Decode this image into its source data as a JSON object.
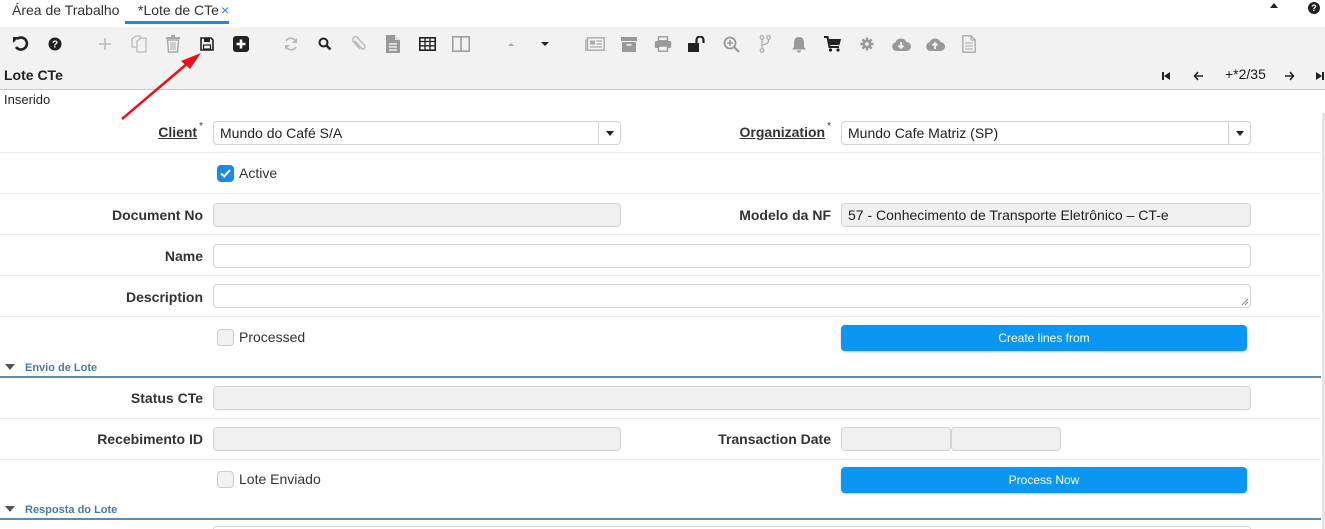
{
  "tabs": [
    {
      "label": "Área de Trabalho",
      "active": false
    },
    {
      "label": "*Lote de CTe",
      "active": true,
      "close": "×"
    }
  ],
  "tabbar_right": {
    "collapse_icon": "caret-up-icon",
    "help": "?"
  },
  "toolbar": {
    "buttons": [
      {
        "name": "undo",
        "icon": "undo-icon",
        "enabled": true
      },
      {
        "name": "help",
        "icon": "help-icon",
        "enabled": true
      },
      {
        "name": "new",
        "icon": "plus-icon",
        "enabled": false
      },
      {
        "name": "copy",
        "icon": "copy-icon",
        "enabled": false
      },
      {
        "name": "delete",
        "icon": "trash-icon",
        "enabled": false
      },
      {
        "name": "save",
        "icon": "save-icon",
        "enabled": true
      },
      {
        "name": "save-and-new",
        "icon": "plus-square-icon",
        "enabled": true
      },
      {
        "name": "refresh",
        "icon": "refresh-icon",
        "enabled": false
      },
      {
        "name": "find",
        "icon": "search-icon",
        "enabled": true
      },
      {
        "name": "attachment",
        "icon": "paperclip-icon",
        "enabled": false
      },
      {
        "name": "note",
        "icon": "document-icon",
        "enabled": false
      },
      {
        "name": "grid-toggle",
        "icon": "grid-icon",
        "enabled": true
      },
      {
        "name": "split-view",
        "icon": "columns-icon",
        "enabled": false
      },
      {
        "name": "previous-record",
        "icon": "caret-up-icon",
        "enabled": false
      },
      {
        "name": "next-record",
        "icon": "caret-down-icon",
        "enabled": true
      },
      {
        "name": "report",
        "icon": "newspaper-icon",
        "enabled": false
      },
      {
        "name": "archive",
        "icon": "archive-icon",
        "enabled": false
      },
      {
        "name": "print",
        "icon": "print-icon",
        "enabled": false
      },
      {
        "name": "lock",
        "icon": "unlock-icon",
        "enabled": true
      },
      {
        "name": "zoom-across",
        "icon": "zoom-in-icon",
        "enabled": false
      },
      {
        "name": "workflow",
        "icon": "branch-icon",
        "enabled": false
      },
      {
        "name": "request",
        "icon": "bell-icon",
        "enabled": false
      },
      {
        "name": "product-info",
        "icon": "cart-icon",
        "enabled": true
      },
      {
        "name": "process",
        "icon": "gear-icon",
        "enabled": false
      },
      {
        "name": "export",
        "icon": "cloud-download-icon",
        "enabled": false
      },
      {
        "name": "import",
        "icon": "cloud-upload-icon",
        "enabled": false
      },
      {
        "name": "file-detail",
        "icon": "file-icon",
        "enabled": false
      }
    ]
  },
  "record": {
    "title": "Lote CTe",
    "counter": "+*2/35",
    "status": "Inserido"
  },
  "form": {
    "client": {
      "label": "Client",
      "required": "*",
      "value": "Mundo do Café S/A"
    },
    "organization": {
      "label": "Organization",
      "required": "*",
      "value": "Mundo Cafe Matriz (SP)"
    },
    "active": {
      "label": "Active",
      "checked": true
    },
    "document_no": {
      "label": "Document No",
      "value": ""
    },
    "modelo_nf": {
      "label": "Modelo da NF",
      "value": "57 - Conhecimento de Transporte Eletrônico – CT-e"
    },
    "name": {
      "label": "Name",
      "value": ""
    },
    "description": {
      "label": "Description",
      "value": ""
    },
    "processed": {
      "label": "Processed",
      "checked": false
    },
    "create_lines_button": "Create lines from"
  },
  "sections": {
    "envio": {
      "title": "Envio de Lote",
      "status_cte": {
        "label": "Status CTe",
        "value": ""
      },
      "recebimento_id": {
        "label": "Recebimento ID",
        "value": ""
      },
      "transaction_date": {
        "label": "Transaction Date",
        "date": "",
        "time": ""
      },
      "lote_enviado": {
        "label": "Lote Enviado",
        "checked": false
      },
      "process_now_button": "Process Now"
    },
    "resposta": {
      "title": "Resposta do Lote"
    }
  },
  "annotation": {
    "arrow_color": "#e8121a",
    "points_to": "save-button"
  }
}
